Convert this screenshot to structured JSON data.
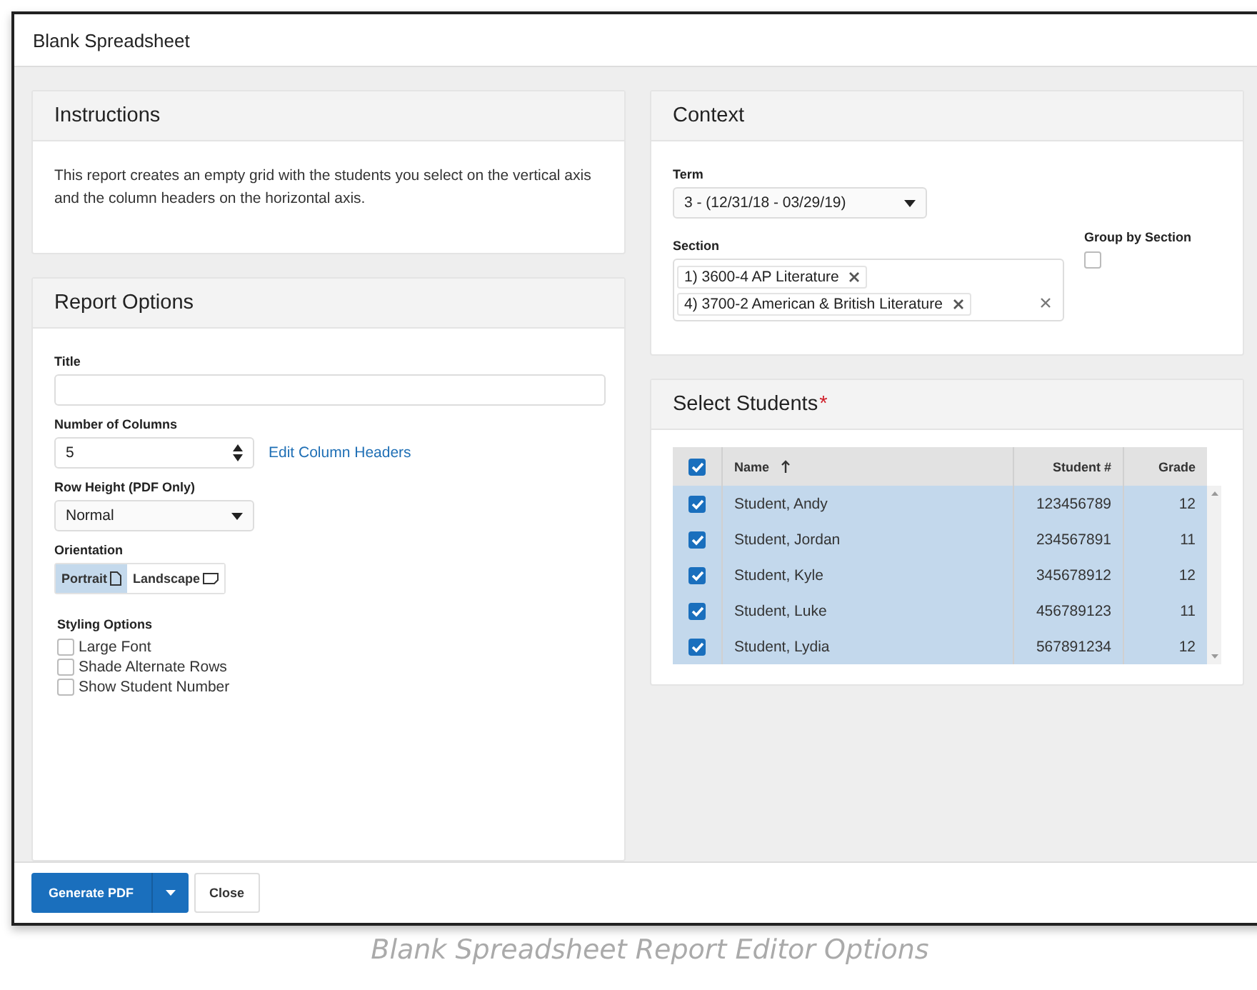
{
  "window": {
    "title": "Blank Spreadsheet"
  },
  "instructions": {
    "title": "Instructions",
    "text": "This report creates an empty grid with the students you select on the vertical axis and the column headers on the horizontal axis."
  },
  "context": {
    "title": "Context",
    "term": {
      "label": "Term",
      "value": "3 - (12/31/18 - 03/29/19)"
    },
    "section": {
      "label": "Section",
      "chips": [
        "1) 3600-4 AP Literature",
        "4) 3700-2 American & British Literature"
      ]
    },
    "group_by_section": {
      "label": "Group by Section",
      "checked": false
    }
  },
  "report_options": {
    "title": "Report Options",
    "title_field": {
      "label": "Title"
    },
    "columns": {
      "label": "Number of Columns",
      "value": "5",
      "link": "Edit Column Headers"
    },
    "row_height": {
      "label": "Row Height (PDF Only)",
      "value": "Normal"
    },
    "orientation": {
      "label": "Orientation",
      "options": [
        {
          "label": "Portrait",
          "kind": "portrait",
          "selected": true
        },
        {
          "label": "Landscape",
          "kind": "landscape",
          "selected": false
        }
      ]
    },
    "styling": {
      "label": "Styling Options",
      "options": [
        {
          "label": "Large Font",
          "checked": false
        },
        {
          "label": "Shade Alternate Rows",
          "checked": false
        },
        {
          "label": "Show Student Number",
          "checked": false
        }
      ]
    }
  },
  "select_students": {
    "title": "Select Students",
    "required_mark": "*",
    "all_checked": true,
    "columns": [
      "Name",
      "Student #",
      "Grade"
    ],
    "rows": [
      {
        "name": "Student, Andy",
        "number": "123456789",
        "grade": "12",
        "checked": true
      },
      {
        "name": "Student, Jordan",
        "number": "234567891",
        "grade": "11",
        "checked": true
      },
      {
        "name": "Student, Kyle",
        "number": "345678912",
        "grade": "12",
        "checked": true
      },
      {
        "name": "Student, Luke",
        "number": "456789123",
        "grade": "11",
        "checked": true
      },
      {
        "name": "Student, Lydia",
        "number": "567891234",
        "grade": "12",
        "checked": true
      }
    ]
  },
  "footer": {
    "buttons": [
      "Generate PDF",
      "Close"
    ]
  },
  "caption": "Blank Spreadsheet Report Editor Options"
}
